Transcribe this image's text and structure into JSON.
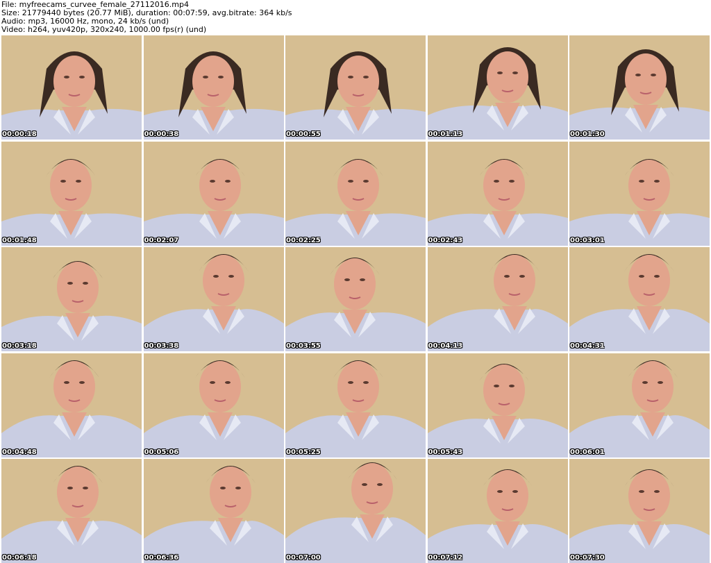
{
  "header": {
    "file_line": "File: myfreecams_curvee_female_27112016.mp4",
    "size_line": "Size: 21779440 bytes (20.77 MiB), duration: 00:07:59, avg.bitrate: 364 kb/s",
    "audio_line": "Audio: mp3, 16000 Hz, mono, 24 kb/s (und)",
    "video_line": "Video: h264, yuv420p, 320x240, 1000.00 fps(r) (und)"
  },
  "thumbnails": [
    {
      "timestamp": "00:00:18"
    },
    {
      "timestamp": "00:00:38"
    },
    {
      "timestamp": "00:00:55"
    },
    {
      "timestamp": "00:01:13"
    },
    {
      "timestamp": "00:01:30"
    },
    {
      "timestamp": "00:01:48"
    },
    {
      "timestamp": "00:02:07"
    },
    {
      "timestamp": "00:02:25"
    },
    {
      "timestamp": "00:02:43"
    },
    {
      "timestamp": "00:03:01"
    },
    {
      "timestamp": "00:03:18"
    },
    {
      "timestamp": "00:03:38"
    },
    {
      "timestamp": "00:03:55"
    },
    {
      "timestamp": "00:04:13"
    },
    {
      "timestamp": "00:04:31"
    },
    {
      "timestamp": "00:04:48"
    },
    {
      "timestamp": "00:05:06"
    },
    {
      "timestamp": "00:05:25"
    },
    {
      "timestamp": "00:05:43"
    },
    {
      "timestamp": "00:06:01"
    },
    {
      "timestamp": "00:06:18"
    },
    {
      "timestamp": "00:06:36"
    },
    {
      "timestamp": "00:07:00"
    },
    {
      "timestamp": "00:07:12"
    },
    {
      "timestamp": "00:07:30"
    }
  ],
  "colors": {
    "background": "#d6be92",
    "shirt": "#c9cde2",
    "skin": "#e2a48c",
    "hair": "#3a2a22"
  }
}
